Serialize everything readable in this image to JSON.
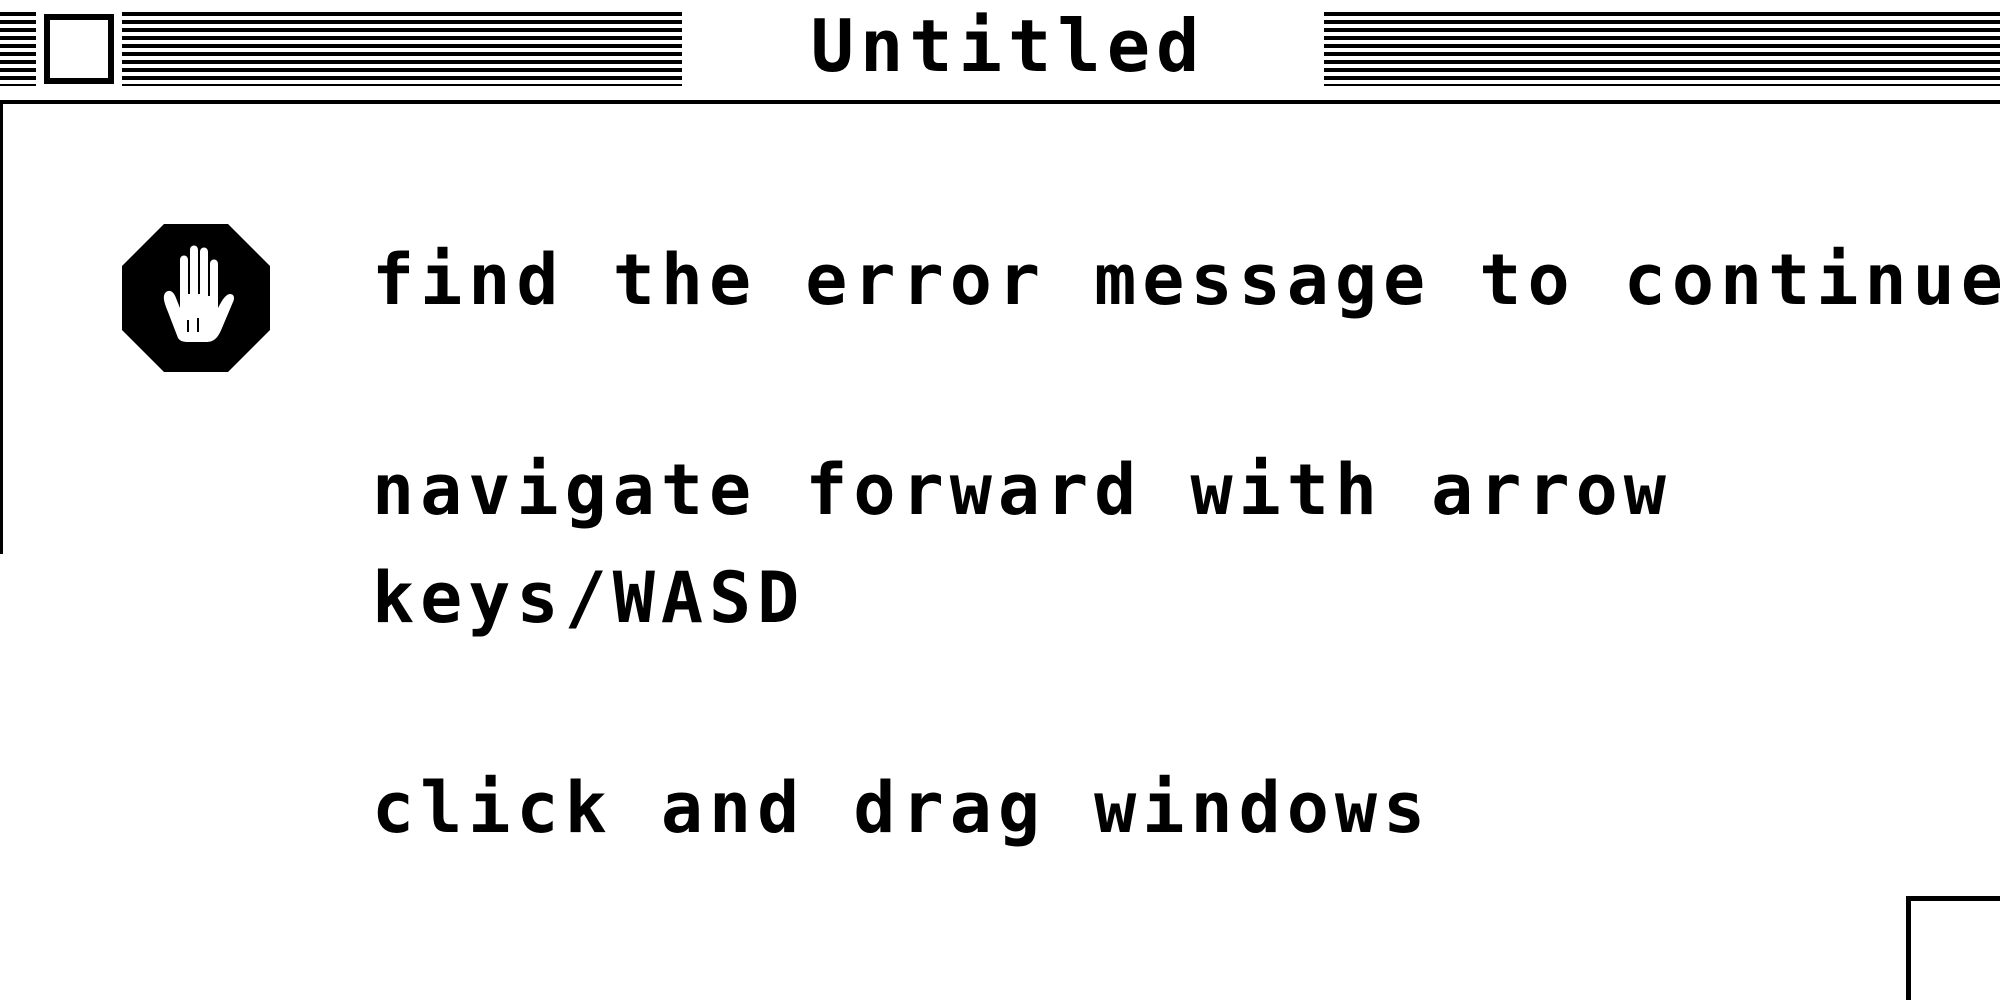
{
  "window": {
    "title": "Untitled"
  },
  "icons": {
    "close_box": "close-box-icon",
    "stop": "stop-hand-icon",
    "grow_box": "resize-grip-icon"
  },
  "messages": {
    "line1": "find the error message to continue",
    "line2": "navigate forward with arrow\nkeys/WASD",
    "line3": "click and drag windows"
  },
  "colors": {
    "foreground": "#000000",
    "background": "#ffffff"
  }
}
